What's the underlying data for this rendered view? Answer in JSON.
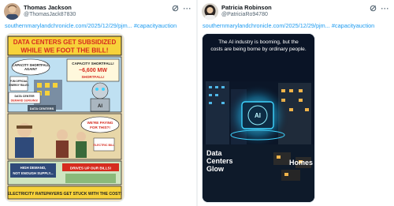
{
  "tweets": [
    {
      "author_name": "Thomas Jackson",
      "author_handle": "@ThomasJack87830",
      "link_text": "southernmarylandchronicle.com/2025/12/29/pjm...",
      "hashtag": "#capacityauction",
      "image": {
        "title_line1": "DATA CENTERS GET SUBSIDIZED",
        "title_line2": "WHILE WE FOOT THE BILL!",
        "bubble_shortfall_q": "CAPACITY SHORTFALL AGAIN?",
        "bubble_shortfall": "CAPACITY SHORTFALL!",
        "shortfall_amount": "~6,600 MW",
        "shortfall_label": "SHORTFALL!",
        "small_left": "PJM OFFICIAL ENERGY RULES",
        "data_center_demand": "DATA CENTER DEMAND SURGING!",
        "data_centers": "DATA CENTERS",
        "robot_label": "AI",
        "paying_bubble": "WE'RE PAYING FOR THIS?!",
        "electric_bill": "ELECTRIC BILL",
        "high_demand": "HIGH DEMAND, NOT ENOUGH SUPPLY...",
        "drives_up": "DRIVES UP OUR BILLS!",
        "footer": "ELECTRICITY RATEPAYERS GET STUCK WITH THE COST!"
      }
    },
    {
      "author_name": "Patricia Robinson",
      "author_handle": "@PatriciaRo94780",
      "link_text": "southernmarylandchronicle.com/2025/12/29/pjm...",
      "hashtag": "#capacityauction",
      "image": {
        "headline": "The AI industry is booming, but the costs are being borne by ordinary people.",
        "headline_line1": "The AI industry is booming, but the",
        "headline_line2": "costs are being borne by ordinary people.",
        "chip_label": "AI",
        "left_caption_1": "Data",
        "left_caption_2": "Centers",
        "left_caption_3": "Glow",
        "right_caption": "Homes"
      }
    }
  ],
  "colors": {
    "link": "#1d9bf0",
    "name": "#0f1419",
    "handle": "#536471",
    "comic_red": "#d62b1f",
    "comic_yellow": "#f7d23a",
    "night_bg": "#0b1628",
    "glow": "#3ed4ff"
  },
  "icons": [
    "grok-icon",
    "more-options-icon"
  ]
}
